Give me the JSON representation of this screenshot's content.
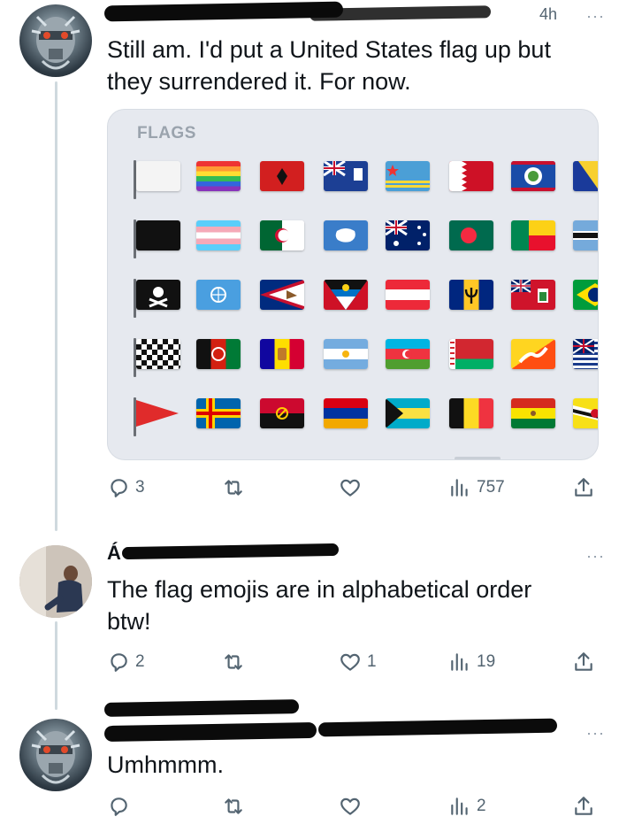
{
  "tweets": [
    {
      "text": "Still am.  I'd put a United States flag up but they surrendered it.  For now.",
      "media_title": "FLAGS",
      "replies": "3",
      "retweets": "",
      "likes": "",
      "views": "757",
      "time": "4h"
    },
    {
      "text": "The flag emojis are in alphabetical order btw!",
      "replies": "2",
      "retweets": "",
      "likes": "1",
      "views": "19",
      "name_initial": "Á"
    },
    {
      "text": "Umhmmm.",
      "replies": "",
      "retweets": "",
      "likes": "",
      "views": "2"
    }
  ],
  "icons": {
    "reply": "reply-icon",
    "retweet": "retweet-icon",
    "like": "heart-icon",
    "views": "views-icon",
    "share": "share-icon",
    "more": "more-icon",
    "verified": "verified-icon"
  },
  "colors": {
    "text": "#0f1419",
    "secondary": "#536471",
    "thread_line": "#cfd9de",
    "media_bg": "#e6e9ef"
  }
}
